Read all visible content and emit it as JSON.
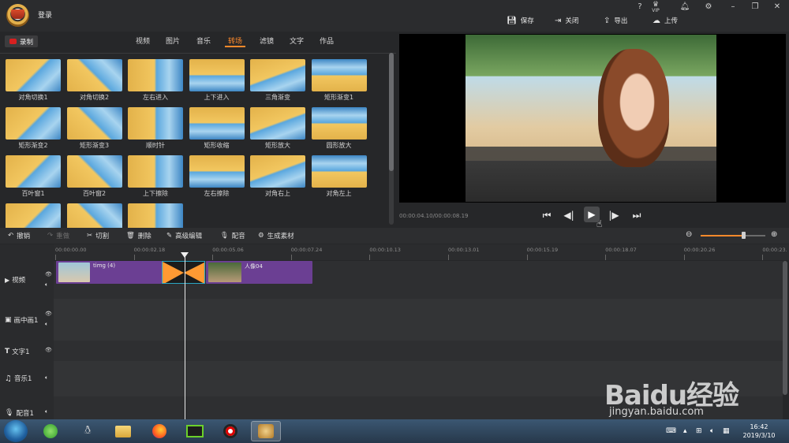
{
  "header": {
    "login_label": "登录",
    "sys_icons": [
      "?",
      "VIP",
      "bell",
      "gear",
      "minimize",
      "restore",
      "close"
    ],
    "sys_labels": {
      "help": "?",
      "vip": "VIP"
    },
    "save_label": "保存",
    "close_label": "关闭",
    "export_label": "导出",
    "upload_label": "上传"
  },
  "left_panel": {
    "record_label": "录制",
    "tabs": [
      {
        "label": "视频",
        "active": false
      },
      {
        "label": "图片",
        "active": false
      },
      {
        "label": "音乐",
        "active": false
      },
      {
        "label": "转场",
        "active": true
      },
      {
        "label": "滤镜",
        "active": false
      },
      {
        "label": "文字",
        "active": false
      },
      {
        "label": "作品",
        "active": false
      }
    ],
    "transitions": [
      "对角切换1",
      "对角切换2",
      "左右进入",
      "上下进入",
      "三角渐变",
      "矩形渐变1",
      "矩形渐变2",
      "矩形渐变3",
      "顺时针",
      "矩形收缩",
      "矩形放大",
      "圆形放大",
      "百叶窗1",
      "百叶窗2",
      "上下擦除",
      "左右擦除",
      "对角右上",
      "对角左上",
      "",
      "",
      ""
    ]
  },
  "preview": {
    "timecode": "00:00:04.10/00:00:08.19"
  },
  "toolbar": {
    "undo_label": "撤销",
    "redo_label": "重做",
    "cut_label": "切割",
    "delete_label": "删除",
    "advanced_edit_label": "高级编辑",
    "dub_label": "配音",
    "generate_label": "生成素材",
    "zoom_level": 0.67
  },
  "timeline": {
    "ruler": [
      "00:00:00.00",
      "00:00:02.18",
      "00:00:05.06",
      "00:00:07.24",
      "00:00:10.13",
      "00:00:13.01",
      "00:00:15.19",
      "00:00:18.07",
      "00:00:20.26",
      "00:00:23."
    ],
    "tracks": [
      {
        "label": "视频",
        "icon": "play-icon"
      },
      {
        "label": "画中画1",
        "icon": "pip-icon"
      },
      {
        "label": "文字1",
        "icon": "text-icon"
      },
      {
        "label": "音乐1",
        "icon": "music-icon"
      },
      {
        "label": "配音1",
        "icon": "mic-icon"
      }
    ],
    "clips": [
      {
        "name": "timg (4)"
      },
      {
        "name": "人像04"
      }
    ]
  },
  "taskbar": {
    "time": "16:42",
    "date": "2019/3/10"
  },
  "watermark": {
    "text": "Baidu经验",
    "url": "jingyan.baidu.com"
  },
  "colors": {
    "accent": "#ff8a2b",
    "clip": "#6b3f93",
    "record": "#d72020"
  }
}
